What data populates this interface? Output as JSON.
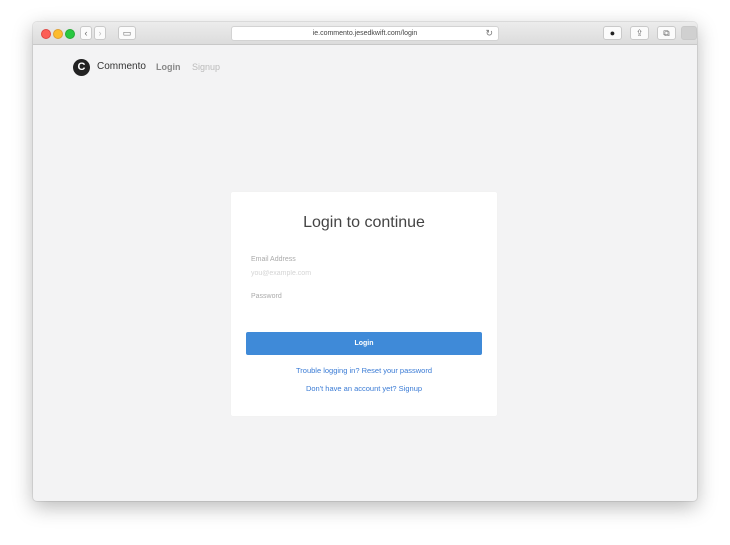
{
  "browser": {
    "url": "ie.commento.jesedkwift.com/login",
    "reload_icon": "reload-icon",
    "share_icon": "share-icon",
    "tabs_icon": "tabs-icon",
    "sidebar_icon": "sidebar-icon",
    "extension_icon": "extension-icon"
  },
  "nav": {
    "logo_letter": "C",
    "brand": "Commento",
    "login": "Login",
    "signup": "Signup"
  },
  "card": {
    "title": "Login to continue",
    "email_label": "Email Address",
    "email_placeholder": "you@example.com",
    "password_label": "Password",
    "password_placeholder": "",
    "login_button": "Login",
    "trouble_text": "Trouble logging in? Reset your password",
    "signup_text": "Don't have an account yet? Signup"
  },
  "colors": {
    "accent": "#3f8ad8",
    "link": "#3a7bd5"
  }
}
